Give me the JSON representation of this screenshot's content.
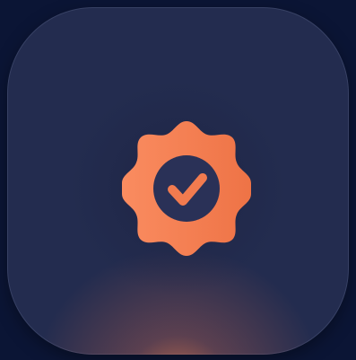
{
  "app_icon": {
    "name": "verified-badge",
    "icon": "verified-check-badge-icon",
    "colors": {
      "page_background": "#0b1535",
      "tile_background": "#232c4f",
      "badge_light": "#f98a5e",
      "badge_dark": "#ef7448",
      "check_ring_fill": "#2a3157"
    }
  }
}
